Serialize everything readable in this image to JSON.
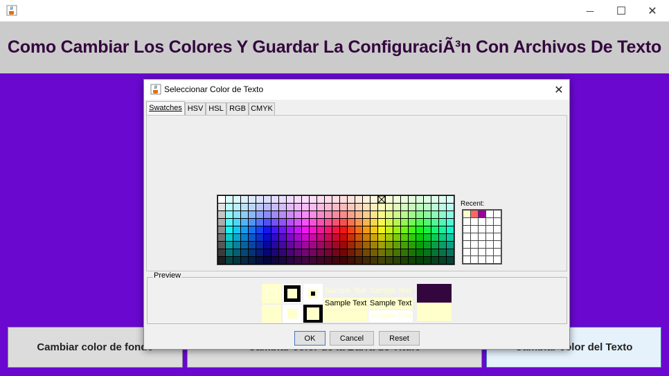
{
  "window": {
    "title": "",
    "icon": "java-cup-icon",
    "controls": {
      "minimize": "—",
      "maximize": "☐",
      "close": "✕"
    }
  },
  "header": {
    "title": "Como Cambiar Los Colores Y Guardar La ConfiguraciÃ³n Con Archivos De Texto",
    "background": "#cbcbcb",
    "text_color": "#33073d"
  },
  "main": {
    "background": "#6a08cf",
    "buttons": [
      {
        "label": "Cambiar color de fondo"
      },
      {
        "label": "Cambiar color de la Barra de Título"
      },
      {
        "label": "Cambiar color del Texto"
      }
    ]
  },
  "dialog": {
    "title": "Seleccionar Color de Texto",
    "icon": "java-cup-icon",
    "close": "✕",
    "tabs": [
      "Swatches",
      "HSV",
      "HSL",
      "RGB",
      "CMYK"
    ],
    "selected_tab": "Swatches",
    "recent_label": "Recent:",
    "recent_colors": [
      "#ffffcc",
      "#ff6666",
      "#990099"
    ],
    "selected_color": "#ffffcc",
    "preview": {
      "legend": "Preview",
      "sample_text": "Sample Text",
      "dark_color": "#33073d"
    },
    "buttons": {
      "ok": "OK",
      "cancel": "Cancel",
      "reset": "Reset"
    }
  }
}
